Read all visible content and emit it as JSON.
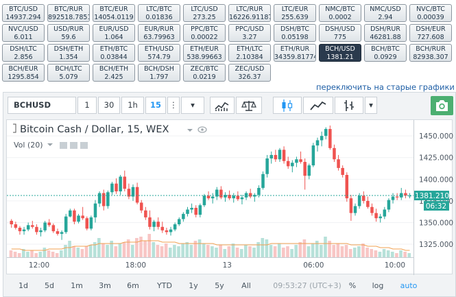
{
  "pairs": [
    {
      "name": "BTC/USD",
      "value": "14937.294"
    },
    {
      "name": "BTC/RUR",
      "value": "892518.7851"
    },
    {
      "name": "BTC/EUR",
      "value": "14054.0119"
    },
    {
      "name": "LTC/BTC",
      "value": "0.01836"
    },
    {
      "name": "LTC/USD",
      "value": "273.25"
    },
    {
      "name": "LTC/RUR",
      "value": "16226.91187"
    },
    {
      "name": "LTC/EUR",
      "value": "255.639"
    },
    {
      "name": "NMC/BTC",
      "value": "0.0002"
    },
    {
      "name": "NMC/USD",
      "value": "2.94"
    },
    {
      "name": "NVC/BTC",
      "value": "0.00039"
    },
    {
      "name": "NVC/USD",
      "value": "6.011"
    },
    {
      "name": "USD/RUR",
      "value": "59.6"
    },
    {
      "name": "EUR/USD",
      "value": "1.064"
    },
    {
      "name": "EUR/RUR",
      "value": "63.79963"
    },
    {
      "name": "PPC/BTC",
      "value": "0.00022"
    },
    {
      "name": "PPC/USD",
      "value": "3.27"
    },
    {
      "name": "DSH/BTC",
      "value": "0.05198"
    },
    {
      "name": "DSH/USD",
      "value": "775"
    },
    {
      "name": "DSH/RUR",
      "value": "46281.88"
    },
    {
      "name": "DSH/EUR",
      "value": "727.608"
    },
    {
      "name": "DSH/LTC",
      "value": "2.856"
    },
    {
      "name": "DSH/ETH",
      "value": "1.354"
    },
    {
      "name": "ETH/BTC",
      "value": "0.03844"
    },
    {
      "name": "ETH/USD",
      "value": "574.79"
    },
    {
      "name": "ETH/EUR",
      "value": "538.99663"
    },
    {
      "name": "ETH/LTC",
      "value": "2.10384"
    },
    {
      "name": "ETH/RUR",
      "value": "34359.81774"
    },
    {
      "name": "BCH/USD",
      "value": "1381.21"
    },
    {
      "name": "BCH/BTC",
      "value": "0.0929"
    },
    {
      "name": "BCH/RUR",
      "value": "82938.307"
    },
    {
      "name": "BCH/EUR",
      "value": "1295.854"
    },
    {
      "name": "BCH/LTC",
      "value": "5.079"
    },
    {
      "name": "BCH/ETH",
      "value": "2.425"
    },
    {
      "name": "BCH/DSH",
      "value": "1.797"
    },
    {
      "name": "ZEC/BTC",
      "value": "0.0219"
    },
    {
      "name": "ZEC/USD",
      "value": "326.37"
    }
  ],
  "active_pair": "BCH/USD",
  "switch_link": "переключить на старые графики",
  "toolbar": {
    "symbol": "BCHUSD",
    "intervals": [
      "1",
      "30",
      "1h",
      "15"
    ],
    "active_interval": "15",
    "dots": "⋮",
    "caret": "▾"
  },
  "legend": {
    "title": "Bitcoin Cash / Dollar, 15, WEX",
    "vol": "Vol (20)"
  },
  "price_axis": {
    "ticks": [
      "1450.000",
      "1425.000",
      "1400.000",
      "1375.000",
      "1350.000",
      "1325.000"
    ]
  },
  "time_axis": {
    "ticks": [
      "12:00",
      "18:00",
      "13",
      "06:00",
      "10:00"
    ]
  },
  "last_price": "1381.210",
  "countdown": "06:32",
  "colors": {
    "up": "#26a69a",
    "down": "#ef5350",
    "ma": "#f0a050",
    "active": "#2a3a4d",
    "accent": "#2196f3",
    "camera": "#4caf71"
  },
  "bottom": {
    "ranges": [
      "1d",
      "5d",
      "1m",
      "3m",
      "6m",
      "YTD",
      "1y",
      "5y",
      "All"
    ],
    "time": "09:53:27 (UTC+3)",
    "percent": "%",
    "log": "log",
    "auto": "auto"
  },
  "chart_data": {
    "type": "candlestick",
    "title": "Bitcoin Cash / Dollar, 15, WEX",
    "x_ticks": [
      "12:00",
      "18:00",
      "13",
      "06:00",
      "10:00"
    ],
    "y_ticks": [
      1450,
      1425,
      1400,
      1375,
      1350,
      1325
    ],
    "ylim": [
      1310,
      1462
    ],
    "last": 1381.21,
    "candles": [
      [
        1352,
        1354,
        1344,
        1348
      ],
      [
        1348,
        1351,
        1342,
        1344
      ],
      [
        1344,
        1346,
        1336,
        1340
      ],
      [
        1340,
        1345,
        1336,
        1342
      ],
      [
        1342,
        1350,
        1340,
        1347
      ],
      [
        1347,
        1352,
        1343,
        1345
      ],
      [
        1345,
        1348,
        1336,
        1339
      ],
      [
        1339,
        1344,
        1334,
        1341
      ],
      [
        1341,
        1352,
        1339,
        1350
      ],
      [
        1350,
        1354,
        1345,
        1347
      ],
      [
        1347,
        1349,
        1338,
        1340
      ],
      [
        1340,
        1343,
        1335,
        1337
      ],
      [
        1337,
        1341,
        1330,
        1339
      ],
      [
        1339,
        1360,
        1337,
        1357
      ],
      [
        1357,
        1366,
        1356,
        1364
      ],
      [
        1364,
        1366,
        1348,
        1351
      ],
      [
        1351,
        1360,
        1349,
        1358
      ],
      [
        1358,
        1368,
        1353,
        1355
      ],
      [
        1355,
        1357,
        1341,
        1343
      ],
      [
        1343,
        1358,
        1341,
        1356
      ],
      [
        1356,
        1376,
        1350,
        1372
      ],
      [
        1372,
        1386,
        1368,
        1384
      ],
      [
        1384,
        1388,
        1364,
        1369
      ],
      [
        1369,
        1387,
        1366,
        1385
      ],
      [
        1385,
        1397,
        1382,
        1395
      ],
      [
        1395,
        1401,
        1383,
        1386
      ],
      [
        1386,
        1405,
        1382,
        1403
      ],
      [
        1403,
        1410,
        1386,
        1389
      ],
      [
        1389,
        1395,
        1377,
        1380
      ],
      [
        1380,
        1394,
        1375,
        1391
      ],
      [
        1391,
        1396,
        1371,
        1373
      ],
      [
        1373,
        1376,
        1361,
        1364
      ],
      [
        1364,
        1368,
        1353,
        1356
      ],
      [
        1356,
        1364,
        1342,
        1345
      ],
      [
        1345,
        1353,
        1340,
        1351
      ],
      [
        1351,
        1356,
        1342,
        1345
      ],
      [
        1345,
        1351,
        1338,
        1341
      ],
      [
        1341,
        1344,
        1336,
        1339
      ],
      [
        1339,
        1345,
        1335,
        1342
      ],
      [
        1342,
        1350,
        1340,
        1348
      ],
      [
        1348,
        1356,
        1346,
        1354
      ],
      [
        1354,
        1362,
        1351,
        1360
      ],
      [
        1360,
        1368,
        1357,
        1365
      ],
      [
        1365,
        1372,
        1361,
        1367
      ],
      [
        1367,
        1370,
        1356,
        1359
      ],
      [
        1359,
        1372,
        1356,
        1370
      ],
      [
        1370,
        1383,
        1368,
        1381
      ],
      [
        1381,
        1386,
        1376,
        1378
      ],
      [
        1378,
        1384,
        1372,
        1380
      ],
      [
        1380,
        1391,
        1376,
        1388
      ],
      [
        1388,
        1392,
        1377,
        1379
      ],
      [
        1379,
        1385,
        1374,
        1382
      ],
      [
        1382,
        1387,
        1376,
        1378
      ],
      [
        1378,
        1384,
        1373,
        1381
      ],
      [
        1381,
        1386,
        1375,
        1377
      ],
      [
        1377,
        1382,
        1371,
        1379
      ],
      [
        1379,
        1386,
        1376,
        1384
      ],
      [
        1384,
        1389,
        1378,
        1380
      ],
      [
        1380,
        1384,
        1374,
        1382
      ],
      [
        1382,
        1393,
        1379,
        1390
      ],
      [
        1390,
        1409,
        1388,
        1406
      ],
      [
        1406,
        1428,
        1402,
        1424
      ],
      [
        1424,
        1432,
        1418,
        1428
      ],
      [
        1428,
        1434,
        1420,
        1423
      ],
      [
        1423,
        1436,
        1420,
        1434
      ],
      [
        1434,
        1438,
        1418,
        1421
      ],
      [
        1421,
        1426,
        1412,
        1415
      ],
      [
        1415,
        1422,
        1408,
        1419
      ],
      [
        1419,
        1426,
        1414,
        1423
      ],
      [
        1423,
        1432,
        1418,
        1420
      ],
      [
        1420,
        1424,
        1388,
        1404
      ],
      [
        1404,
        1418,
        1400,
        1416
      ],
      [
        1416,
        1442,
        1414,
        1439
      ],
      [
        1439,
        1448,
        1432,
        1445
      ],
      [
        1445,
        1455,
        1438,
        1450
      ],
      [
        1450,
        1460,
        1446,
        1458
      ],
      [
        1458,
        1462,
        1434,
        1436
      ],
      [
        1436,
        1440,
        1420,
        1423
      ],
      [
        1423,
        1428,
        1410,
        1413
      ],
      [
        1413,
        1416,
        1402,
        1405
      ],
      [
        1405,
        1408,
        1374,
        1378
      ],
      [
        1378,
        1382,
        1352,
        1361
      ],
      [
        1361,
        1372,
        1358,
        1369
      ],
      [
        1369,
        1384,
        1366,
        1381
      ],
      [
        1381,
        1386,
        1372,
        1375
      ],
      [
        1375,
        1380,
        1366,
        1368
      ],
      [
        1368,
        1372,
        1358,
        1361
      ],
      [
        1361,
        1366,
        1351,
        1355
      ],
      [
        1355,
        1360,
        1350,
        1357
      ],
      [
        1357,
        1368,
        1354,
        1365
      ],
      [
        1365,
        1378,
        1362,
        1376
      ],
      [
        1376,
        1384,
        1372,
        1380
      ],
      [
        1380,
        1384,
        1376,
        1379
      ],
      [
        1379,
        1390,
        1376,
        1384
      ],
      [
        1384,
        1388,
        1378,
        1381
      ],
      [
        1381,
        1384,
        1378,
        1381
      ]
    ],
    "volume": [
      5,
      4,
      3,
      6,
      4,
      5,
      3,
      4,
      7,
      5,
      4,
      3,
      5,
      9,
      12,
      8,
      7,
      6,
      8,
      9,
      11,
      14,
      10,
      9,
      12,
      8,
      10,
      11,
      13,
      9,
      14,
      15,
      12,
      17,
      11,
      9,
      8,
      10,
      7,
      9,
      8,
      10,
      11,
      9,
      12,
      13,
      10,
      9,
      8,
      7,
      9,
      6,
      8,
      10,
      7,
      6,
      9,
      8,
      7,
      11,
      14,
      13,
      9,
      8,
      10,
      7,
      8,
      6,
      9,
      11,
      13,
      8,
      10,
      12,
      9,
      15,
      12,
      9,
      10,
      8,
      9,
      6,
      7,
      8,
      10,
      7,
      6,
      5,
      4,
      6,
      5,
      4,
      3,
      5,
      4,
      3
    ],
    "ma_line": [
      6,
      6,
      6,
      5,
      5,
      5,
      5,
      5,
      5,
      6,
      6,
      6,
      6,
      7,
      7,
      8,
      8,
      8,
      8,
      9,
      9,
      10,
      10,
      10,
      10,
      10,
      10,
      11,
      11,
      11,
      11,
      12,
      12,
      12,
      12,
      12,
      11,
      11,
      11,
      11,
      10,
      10,
      10,
      10,
      10,
      10,
      10,
      10,
      10,
      9,
      9,
      9,
      9,
      9,
      9,
      9,
      9,
      9,
      9,
      9,
      9,
      9,
      10,
      10,
      10,
      10,
      10,
      10,
      10,
      10,
      10,
      10,
      10,
      10,
      10,
      10,
      10,
      10,
      10,
      10,
      10,
      9,
      9,
      9,
      9,
      8,
      8,
      8,
      7,
      7,
      7,
      6,
      6,
      6,
      5,
      5
    ]
  }
}
